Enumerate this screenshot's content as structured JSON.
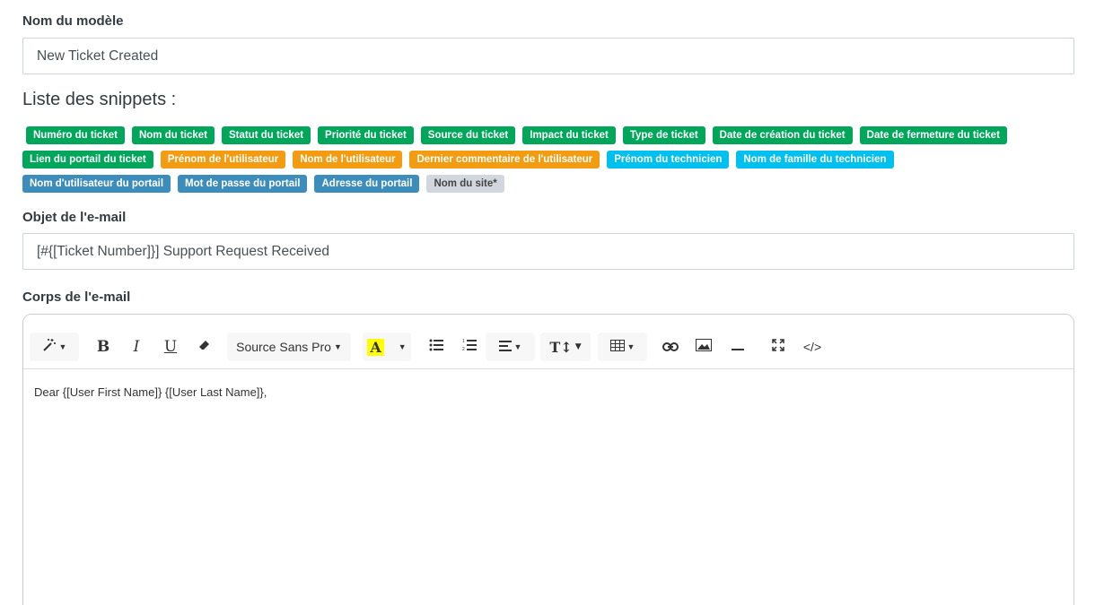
{
  "template_name": {
    "label": "Nom du modèle",
    "value": "New Ticket Created"
  },
  "snippets": {
    "title": "Liste des snippets :",
    "rows": [
      [
        {
          "label": "Numéro du ticket",
          "color": "green"
        },
        {
          "label": "Nom du ticket",
          "color": "green"
        },
        {
          "label": "Statut du ticket",
          "color": "green"
        },
        {
          "label": "Priorité du ticket",
          "color": "green"
        },
        {
          "label": "Source du ticket",
          "color": "green"
        },
        {
          "label": "Impact du ticket",
          "color": "green"
        },
        {
          "label": "Type de ticket",
          "color": "green"
        },
        {
          "label": "Date de création du ticket",
          "color": "green"
        },
        {
          "label": "Date de fermeture du ticket",
          "color": "green"
        }
      ],
      [
        {
          "label": "Lien du portail du ticket",
          "color": "green"
        },
        {
          "label": "Prénom de l'utilisateur",
          "color": "orange"
        },
        {
          "label": "Nom de l'utilisateur",
          "color": "orange"
        },
        {
          "label": "Dernier commentaire de l'utilisateur",
          "color": "orange"
        },
        {
          "label": "Prénom du technicien",
          "color": "cyan"
        },
        {
          "label": "Nom de famille du technicien",
          "color": "cyan"
        }
      ],
      [
        {
          "label": "Nom d'utilisateur du portail",
          "color": "blue"
        },
        {
          "label": "Mot de passe du portail",
          "color": "blue"
        },
        {
          "label": "Adresse du portail",
          "color": "blue"
        },
        {
          "label": "Nom du site*",
          "color": "gray"
        }
      ]
    ]
  },
  "email_subject": {
    "label": "Objet de l'e-mail",
    "value": "[#{[Ticket Number]}] Support Request Received"
  },
  "email_body": {
    "label": "Corps de l'e-mail",
    "toolbar": {
      "font_name": "Source Sans Pro",
      "icons": [
        "magic-icon",
        "bold-icon",
        "italic-icon",
        "underline-icon",
        "eraser-icon",
        "font-color-icon",
        "unordered-list-icon",
        "ordered-list-icon",
        "align-icon",
        "text-height-icon",
        "table-icon",
        "link-icon",
        "image-icon",
        "horizontal-rule-icon",
        "fullscreen-icon",
        "code-view-icon"
      ],
      "bold": "B",
      "italic": "I",
      "underline": "U",
      "color_letter": "A",
      "text_height": "T↕",
      "code": "</>"
    },
    "content": "Dear {[User First Name]} {[User Last Name]},"
  },
  "colors": {
    "green": "#00a65a",
    "orange": "#f39c12",
    "cyan": "#00c0ef",
    "blue": "#3c8dbc",
    "gray": "#d2d6de"
  }
}
